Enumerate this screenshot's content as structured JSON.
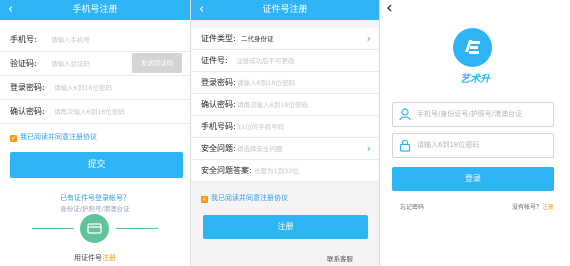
{
  "phone_register": {
    "back_icon": "chevron-left-icon",
    "title": "手机号注册",
    "fields": [
      {
        "label": "手机号:",
        "placeholder": "请输入手机号"
      },
      {
        "label": "验证码:",
        "placeholder": "请输入验证码"
      },
      {
        "label": "登录密码:",
        "placeholder": "请输入6到18位密码"
      },
      {
        "label": "确认密码:",
        "placeholder": "请再次输入6到18位密码"
      }
    ],
    "send_code_label": "发送验证码",
    "agree_text": "我已阅读并同意注册协议",
    "submit_label": "提交",
    "id_register_link": "已有证件号登录帐号？",
    "id_register_hint": "身份证/护照号/港澳台证",
    "id_register_prefix": "用证件号",
    "id_register_suffix": "注册"
  },
  "id_register": {
    "back_icon": "chevron-left-icon",
    "title": "证件号注册",
    "fields": [
      {
        "label": "证件类型:",
        "value": "二代身份证",
        "chevron": true
      },
      {
        "label": "证件号:",
        "placeholder": "注册成功后不可更改"
      },
      {
        "label": "登录密码:",
        "placeholder": "请输入6到18位密码"
      },
      {
        "label": "确认密码:",
        "placeholder": "请再次输入6到18位密码"
      },
      {
        "label": "手机号码:",
        "placeholder": "11位的手机号码"
      },
      {
        "label": "安全问题:",
        "placeholder": "请选择安全问题",
        "chevron": true
      },
      {
        "label": "安全问题答案:",
        "placeholder": "长度为1到32位"
      }
    ],
    "agree_text": "我已阅读并同意注册协议",
    "register_label": "注册",
    "contact_service": "联系客服"
  },
  "login": {
    "back_icon": "chevron-left-icon",
    "app_name": "艺术升",
    "account_placeholder": "手机号/身份证号/护照号/港澳台证",
    "password_placeholder": "请输入6到18位密码",
    "login_label": "登录",
    "forgot_password": "忘记密码",
    "no_account": "没有帐号？",
    "register_link": "注册"
  },
  "colors": {
    "primary": "#2eb4f4",
    "link": "#2e9fe6",
    "accent_orange": "#f39c1f",
    "placeholder": "#c6c6c6"
  }
}
